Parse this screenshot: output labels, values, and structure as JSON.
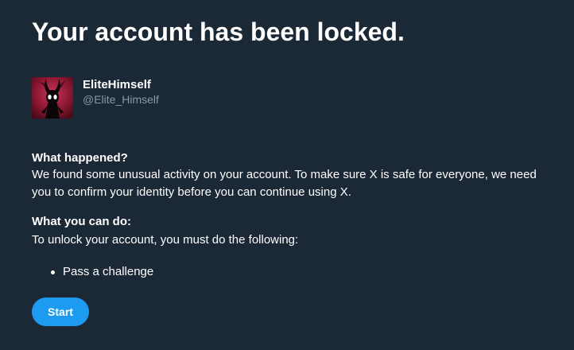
{
  "title": "Your account has been locked.",
  "account": {
    "display_name": "EliteHimself",
    "handle": "@Elite_Himself"
  },
  "what_happened": {
    "heading": "What happened?",
    "text": "We found some unusual activity on your account. To make sure X is safe for everyone, we need you to confirm your identity before you can continue using X."
  },
  "what_you_can_do": {
    "heading": "What you can do:",
    "text": "To unlock your account, you must do the following:",
    "steps": [
      "Pass a challenge"
    ]
  },
  "start_button_label": "Start",
  "colors": {
    "background": "#1b2835",
    "text": "#ffffff",
    "muted_text": "#8b98a5",
    "accent": "#1d9bf0",
    "avatar_background": "#8c1731"
  },
  "icons": {
    "avatar": "hollow-knight-avatar-icon"
  }
}
